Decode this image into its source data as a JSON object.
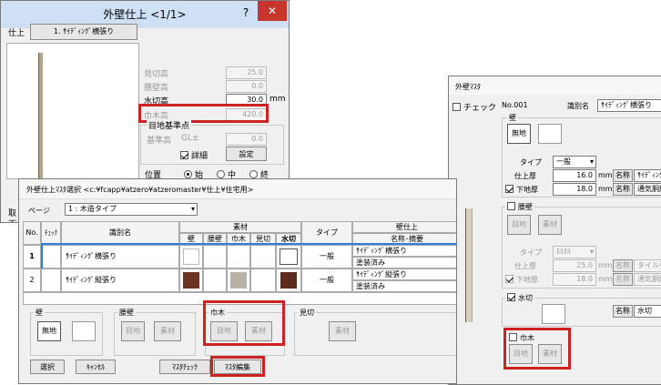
{
  "win1": {
    "title": "外壁仕上 <1/1>",
    "help": "?",
    "close": "✕",
    "finish_label": "仕上",
    "finish_btn": "1. ｻｲﾃﾞｨﾝｸﾞ横張り",
    "fields": [
      {
        "label": "見切高",
        "value": "25.0"
      },
      {
        "label": "腰壁高",
        "value": "0.0"
      },
      {
        "label": "水切高",
        "value": "30.0",
        "unit": "mm"
      },
      {
        "label": "巾木高",
        "value": "420.0"
      }
    ],
    "group_label": "目地基準点",
    "base_label": "基準高",
    "gl_label": "GL±",
    "gl_value": "0.0",
    "detail_label": "詳細",
    "setting_btn": "設定",
    "position_label": "位置",
    "positions": [
      "始",
      "中",
      "終"
    ],
    "left_cut1": "取",
    "left_cut2": "下"
  },
  "win2": {
    "title": "外壁仕上ﾏｽﾀ選択 <c:¥fcapp¥atzero¥atzeromaster¥仕上¥住宅用>",
    "page_label": "ページ",
    "page_value": "1 : 木造タイプ",
    "headers": {
      "no": "No.",
      "check": "ﾁｪｯｸ",
      "name": "識別名",
      "material": "素材",
      "wall": "壁",
      "waist": "腰壁",
      "baseboard": "巾木",
      "mikiri": "見切",
      "mizukiri": "水切",
      "type": "タイプ",
      "finish": "壁仕上",
      "finish_sub": "名称･摘要"
    },
    "rows": [
      {
        "no": "1",
        "name": "ｻｲﾃﾞｨﾝｸﾞ横張り",
        "type": "一般",
        "finish1": "ｻｲﾃﾞｨﾝｸﾞ横張り",
        "finish2": "塗装済み"
      },
      {
        "no": "2",
        "name": "ｻｲﾃﾞｨﾝｸﾞ縦張り",
        "type": "一般",
        "finish1": "ｻｲﾃﾞｨﾝｸﾞ縦張り",
        "finish2": "塗装済み"
      }
    ],
    "groups": {
      "wall": {
        "label": "壁",
        "btn": "無地"
      },
      "waist": {
        "label": "腰壁",
        "joint": "目地",
        "material": "素材"
      },
      "baseboard": {
        "label": "巾木",
        "joint": "目地",
        "material": "素材"
      },
      "mikiri": {
        "label": "見切",
        "material": "素材"
      }
    },
    "footer": {
      "select": "選択",
      "cancel": "ｷｬﾝｾﾙ",
      "master_check": "ﾏｽﾀﾁｪｯｸ",
      "master_edit": "ﾏｽﾀ編集"
    }
  },
  "win3": {
    "title": "外壁ﾏｽﾀ",
    "check_label": "チェック",
    "no_label": "No.001",
    "name_label": "識別名",
    "name_value": "ｻｲﾃﾞｨﾝｸﾞ横張り",
    "wall": {
      "label": "壁",
      "btn": "無地",
      "type_label": "タイプ",
      "type_value": "一般",
      "thick_label": "仕上厚",
      "thick_value": "16.0",
      "unit": "mm",
      "base_label": "下地厚",
      "base_value": "18.0",
      "name_label": "名称",
      "name1": "ｻｲﾃﾞｨﾝｸﾞ横張",
      "name2": "通気胴縁"
    },
    "waist": {
      "label": "腰壁",
      "joint": "目地",
      "material": "素材",
      "type_label": "タイプ",
      "type_value": "ﾓﾙﾀﾙ",
      "thick_label": "仕上厚",
      "thick_value": "25.0",
      "unit": "mm",
      "base_label": "下地厚",
      "base_value": "18.0",
      "name_label": "名称",
      "name1": "タイル張り",
      "name2": "通気胴縁"
    },
    "mizukiri": {
      "label": "水切",
      "name_label": "名称",
      "name_value": "水切"
    },
    "baseboard": {
      "label": "巾木",
      "joint": "目地",
      "material": "素材"
    }
  }
}
